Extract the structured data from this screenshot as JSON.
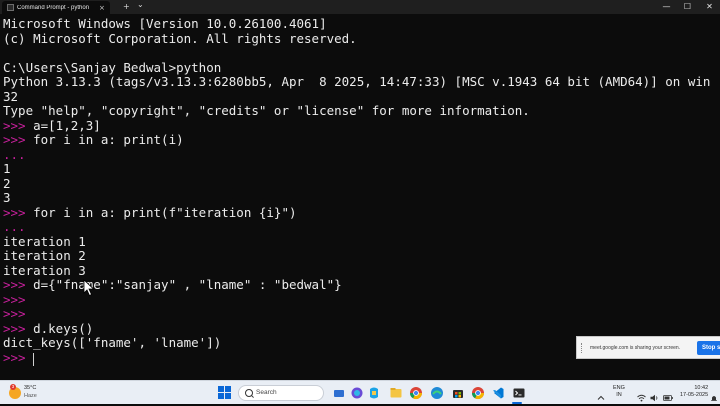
{
  "window": {
    "tab_title": "Command Prompt - python",
    "tab_close": "×",
    "new_tab": "+",
    "dropdown": "⌄",
    "minimize": "—",
    "maximize": "☐",
    "close": "✕"
  },
  "terminal": {
    "lines": [
      {
        "text": "Microsoft Windows [Version 10.0.26100.4061]"
      },
      {
        "text": "(c) Microsoft Corporation. All rights reserved."
      },
      {
        "text": ""
      },
      {
        "text": "C:\\Users\\Sanjay Bedwal>python"
      },
      {
        "text": "Python 3.13.3 (tags/v3.13.3:6280bb5, Apr  8 2025, 14:47:33) [MSC v.1943 64 bit (AMD64)] on win"
      },
      {
        "text": "32"
      },
      {
        "text": "Type \"help\", \"copyright\", \"credits\" or \"license\" for more information."
      },
      {
        "prompt": ">>>",
        "text": " a=[1,2,3]"
      },
      {
        "prompt": ">>>",
        "text": " for i in a: print(i)"
      },
      {
        "prompt": "...",
        "text": ""
      },
      {
        "text": "1"
      },
      {
        "text": "2"
      },
      {
        "text": "3"
      },
      {
        "prompt": ">>>",
        "text": " for i in a: print(f\"iteration {i}\")"
      },
      {
        "prompt": "...",
        "text": ""
      },
      {
        "text": "iteration 1"
      },
      {
        "text": "iteration 2"
      },
      {
        "text": "iteration 3"
      },
      {
        "prompt": ">>>",
        "text": " d={\"fname\":\"sanjay\" , \"lname\" : \"bedwal\"}"
      },
      {
        "prompt": ">>>",
        "text": ""
      },
      {
        "prompt": ">>>",
        "text": ""
      },
      {
        "prompt": ">>>",
        "text": " d.keys()"
      },
      {
        "text": "dict_keys(['fname', 'lname'])"
      },
      {
        "prompt": ">>>",
        "text": " "
      }
    ]
  },
  "share_bar": {
    "message": "meet.google.com is sharing your screen.",
    "stop_label": "Stop sh"
  },
  "taskbar": {
    "weather_badge": "3",
    "temperature": "35°C",
    "condition": "Haze",
    "search_placeholder": "Search",
    "lang_top": "ENG",
    "lang_bottom": "IN",
    "time": "10:42",
    "date": "17-05-2025",
    "apps": [
      "start-icon",
      "search-box",
      "widgets-icon",
      "copilot-icon",
      "file-explorer-icon",
      "chrome-icon",
      "edge-icon",
      "store-icon",
      "chrome-icon",
      "vscode-icon",
      "terminal-icon"
    ]
  },
  "colors": {
    "terminal_bg": "#0c0c0c",
    "terminal_fg": "#ececec",
    "prompt": "#c8209c",
    "taskbar_bg": "#e9eef5",
    "stop_button": "#1a73e8"
  }
}
